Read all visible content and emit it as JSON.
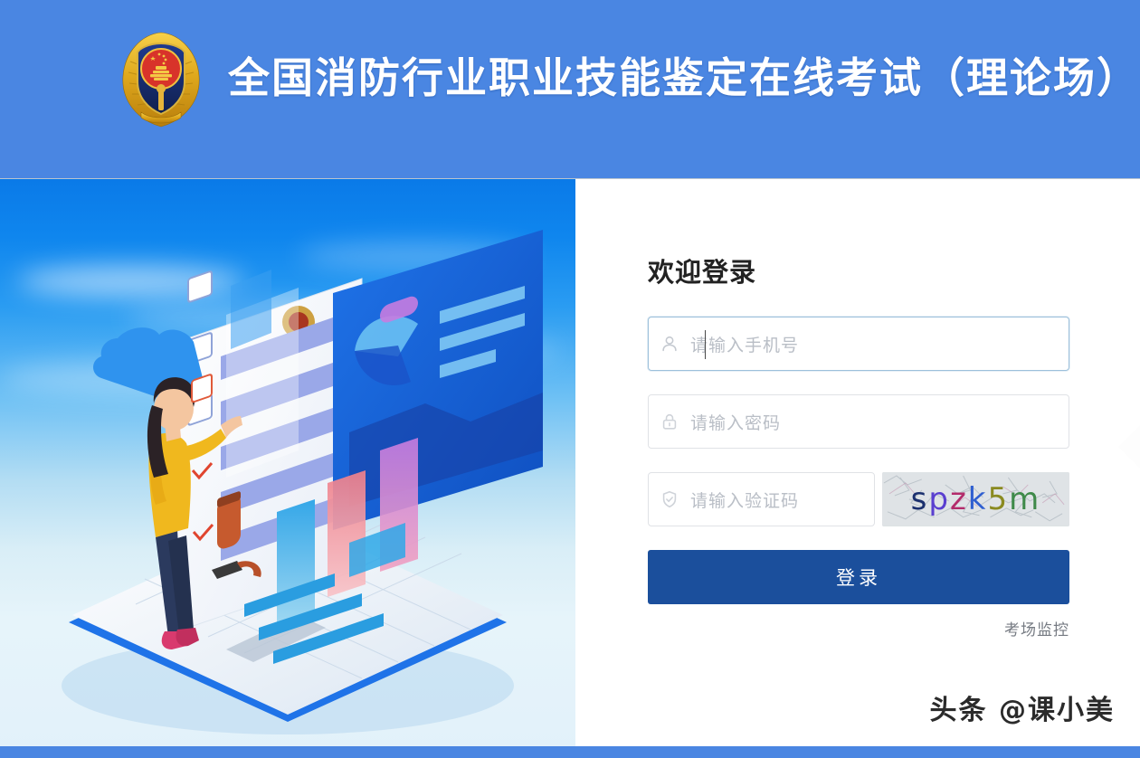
{
  "header": {
    "title": "全国消防行业职业技能鉴定在线考试（理论场）",
    "emblem_icon": "fire-service-emblem-icon",
    "background_color": "#4a86e2",
    "title_color": "#ffffff"
  },
  "illustration": {
    "alt_name": "isometric-exam-illustration",
    "description": "女性人物与在线考试数据面板等距插画"
  },
  "login": {
    "heading": "欢迎登录",
    "fields": [
      {
        "name": "phone",
        "icon": "user-icon",
        "placeholder": "请输入手机号",
        "value": "",
        "focused": true
      },
      {
        "name": "password",
        "icon": "lock-icon",
        "placeholder": "请输入密码",
        "value": "",
        "focused": false
      },
      {
        "name": "captcha",
        "icon": "shield-check-icon",
        "placeholder": "请输入验证码",
        "value": "",
        "focused": false
      }
    ],
    "captcha_image": {
      "name": "captcha-image",
      "text": "spzk5m",
      "characters": [
        {
          "char": "s",
          "color": "#1a2f6e"
        },
        {
          "char": "p",
          "color": "#5a3fd0"
        },
        {
          "char": "z",
          "color": "#b32b6b"
        },
        {
          "char": "k",
          "color": "#2f5fd0"
        },
        {
          "char": "5",
          "color": "#8a8a20"
        },
        {
          "char": "m",
          "color": "#3f8a4a"
        }
      ]
    },
    "submit_label": "登录",
    "submit_color": "#1b4f9c",
    "monitor_link_label": "考场监控"
  },
  "watermark": {
    "text": "头条 @课小美"
  },
  "footer": {
    "strip_color": "#4a86e2"
  }
}
